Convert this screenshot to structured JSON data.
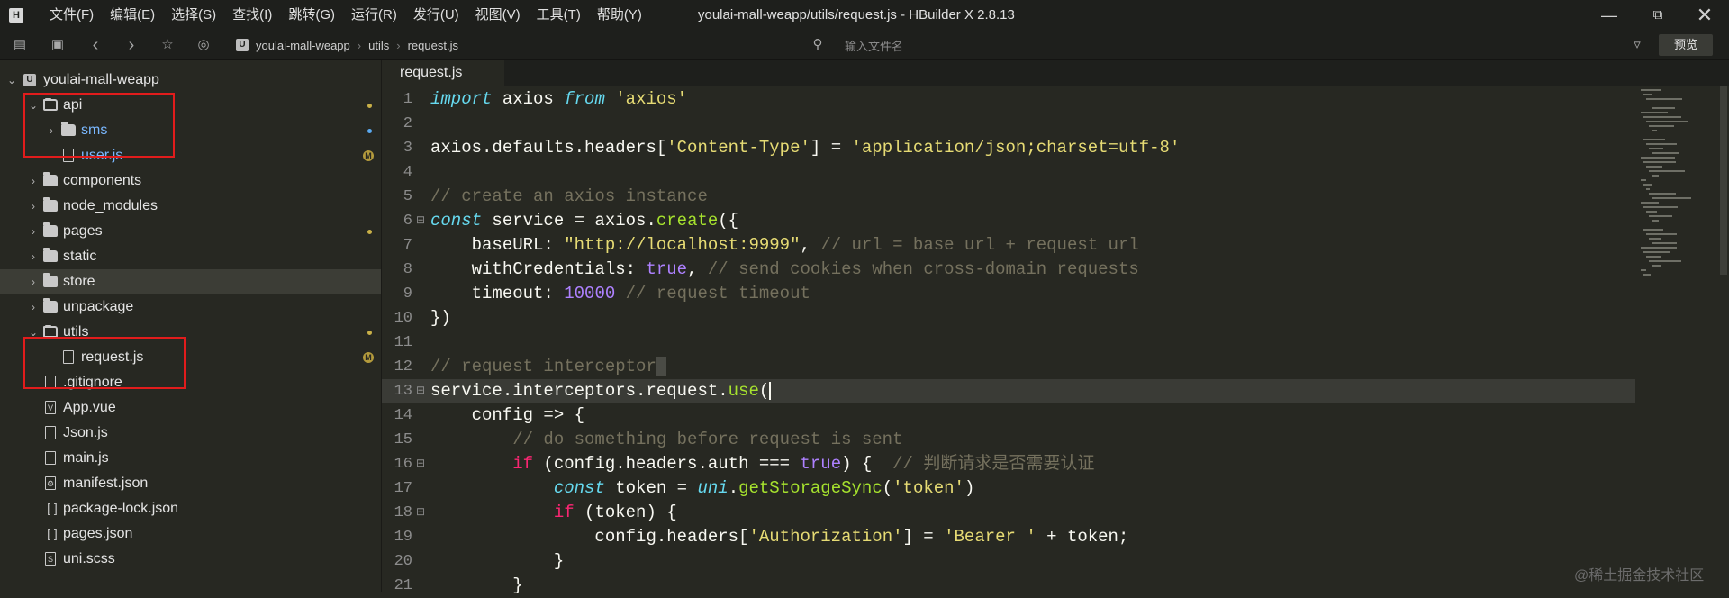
{
  "menubar": {
    "items": [
      "文件(F)",
      "编辑(E)",
      "选择(S)",
      "查找(I)",
      "跳转(G)",
      "运行(R)",
      "发行(U)",
      "视图(V)",
      "工具(T)",
      "帮助(Y)"
    ],
    "window_title": "youlai-mall-weapp/utils/request.js - HBuilder X 2.8.13"
  },
  "toolbar": {
    "breadcrumb": [
      "youlai-mall-weapp",
      "utils",
      "request.js"
    ],
    "search_placeholder": "输入文件名",
    "preview_label": "预览"
  },
  "sidebar": {
    "root": "youlai-mall-weapp",
    "items": [
      {
        "label": "api",
        "type": "folder-open",
        "depth": 1,
        "status": "dot-yellow"
      },
      {
        "label": "sms",
        "type": "folder",
        "depth": 2,
        "status": "dot-blue",
        "blue": true
      },
      {
        "label": "user.js",
        "type": "file",
        "depth": 2,
        "status": "M",
        "blue": true
      },
      {
        "label": "components",
        "type": "folder",
        "depth": 1
      },
      {
        "label": "node_modules",
        "type": "folder",
        "depth": 1
      },
      {
        "label": "pages",
        "type": "folder",
        "depth": 1,
        "status": "dot-yellow"
      },
      {
        "label": "static",
        "type": "folder",
        "depth": 1
      },
      {
        "label": "store",
        "type": "folder",
        "depth": 1,
        "selected": true
      },
      {
        "label": "unpackage",
        "type": "folder",
        "depth": 1
      },
      {
        "label": "utils",
        "type": "folder-open",
        "depth": 1,
        "status": "dot-yellow"
      },
      {
        "label": "request.js",
        "type": "file",
        "depth": 2,
        "status": "M"
      },
      {
        "label": ".gitignore",
        "type": "file",
        "depth": 1
      },
      {
        "label": "App.vue",
        "type": "file-v",
        "depth": 1
      },
      {
        "label": "Json.js",
        "type": "file",
        "depth": 1
      },
      {
        "label": "main.js",
        "type": "file",
        "depth": 1
      },
      {
        "label": "manifest.json",
        "type": "file-gear",
        "depth": 1
      },
      {
        "label": "package-lock.json",
        "type": "file-bracket",
        "depth": 1
      },
      {
        "label": "pages.json",
        "type": "file-bracket",
        "depth": 1
      },
      {
        "label": "uni.scss",
        "type": "file-s",
        "depth": 1
      }
    ]
  },
  "editor": {
    "tab_label": "request.js",
    "lines": [
      {
        "n": "1",
        "tokens": [
          [
            "kw",
            "import"
          ],
          [
            "t",
            " axios "
          ],
          [
            "kw",
            "from"
          ],
          [
            "t",
            " "
          ],
          [
            "str",
            "'axios'"
          ]
        ]
      },
      {
        "n": "2",
        "tokens": []
      },
      {
        "n": "3",
        "tokens": [
          [
            "t",
            "axios.defaults.headers["
          ],
          [
            "str",
            "'Content-Type'"
          ],
          [
            "t",
            "] = "
          ],
          [
            "str",
            "'application/json;charset=utf-8'"
          ]
        ]
      },
      {
        "n": "4",
        "tokens": []
      },
      {
        "n": "5",
        "tokens": [
          [
            "cm",
            "// create an axios instance"
          ]
        ]
      },
      {
        "n": "6",
        "fold": true,
        "tokens": [
          [
            "kw",
            "const"
          ],
          [
            "t",
            " service = axios."
          ],
          [
            "fn",
            "create"
          ],
          [
            "t",
            "({"
          ]
        ]
      },
      {
        "n": "7",
        "tokens": [
          [
            "t",
            "    baseURL: "
          ],
          [
            "str",
            "\"http://localhost:9999\""
          ],
          [
            "t",
            ", "
          ],
          [
            "cm",
            "// url = base url + request url"
          ]
        ]
      },
      {
        "n": "8",
        "tokens": [
          [
            "t",
            "    withCredentials: "
          ],
          [
            "num",
            "true"
          ],
          [
            "t",
            ", "
          ],
          [
            "cm",
            "// send cookies when cross-domain requests"
          ]
        ]
      },
      {
        "n": "9",
        "tokens": [
          [
            "t",
            "    timeout: "
          ],
          [
            "num",
            "10000"
          ],
          [
            "t",
            " "
          ],
          [
            "cm",
            "// request timeout"
          ]
        ]
      },
      {
        "n": "10",
        "tokens": [
          [
            "t",
            "})"
          ]
        ]
      },
      {
        "n": "11",
        "tokens": []
      },
      {
        "n": "12",
        "tokens": [
          [
            "cm",
            "// request interceptor"
          ],
          [
            "sel",
            " "
          ]
        ]
      },
      {
        "n": "13",
        "fold": true,
        "highlight": true,
        "tokens": [
          [
            "t",
            "service.interceptors.request."
          ],
          [
            "fn",
            "use"
          ],
          [
            "t",
            "("
          ],
          [
            "cursor",
            ""
          ]
        ]
      },
      {
        "n": "14",
        "tokens": [
          [
            "t",
            "    config => {"
          ]
        ]
      },
      {
        "n": "15",
        "tokens": [
          [
            "cm",
            "        // do something before request is sent"
          ]
        ]
      },
      {
        "n": "16",
        "fold": true,
        "tokens": [
          [
            "t",
            "        "
          ],
          [
            "kw2",
            "if"
          ],
          [
            "t",
            " (config.headers.auth === "
          ],
          [
            "num",
            "true"
          ],
          [
            "t",
            ") {  "
          ],
          [
            "cm",
            "// 判断请求是否需要认证"
          ]
        ]
      },
      {
        "n": "17",
        "tokens": [
          [
            "t",
            "            "
          ],
          [
            "kw",
            "const"
          ],
          [
            "t",
            " token = "
          ],
          [
            "kw",
            "uni"
          ],
          [
            "t",
            "."
          ],
          [
            "fn",
            "getStorageSync"
          ],
          [
            "t",
            "("
          ],
          [
            "str",
            "'token'"
          ],
          [
            "t",
            ")"
          ]
        ]
      },
      {
        "n": "18",
        "fold": true,
        "tokens": [
          [
            "t",
            "            "
          ],
          [
            "kw2",
            "if"
          ],
          [
            "t",
            " (token) {"
          ]
        ]
      },
      {
        "n": "19",
        "tokens": [
          [
            "t",
            "                config.headers["
          ],
          [
            "str",
            "'Authorization'"
          ],
          [
            "t",
            "] = "
          ],
          [
            "str",
            "'Bearer '"
          ],
          [
            "t",
            " + token;"
          ]
        ]
      },
      {
        "n": "20",
        "tokens": [
          [
            "t",
            "            }"
          ]
        ]
      },
      {
        "n": "21",
        "tokens": [
          [
            "t",
            "        }"
          ]
        ]
      }
    ]
  },
  "watermark": "@稀土掘金技术社区",
  "colors": {
    "background": "#272822",
    "titlebar": "#1e1f1c",
    "highlight_box": "#e11c1c"
  }
}
